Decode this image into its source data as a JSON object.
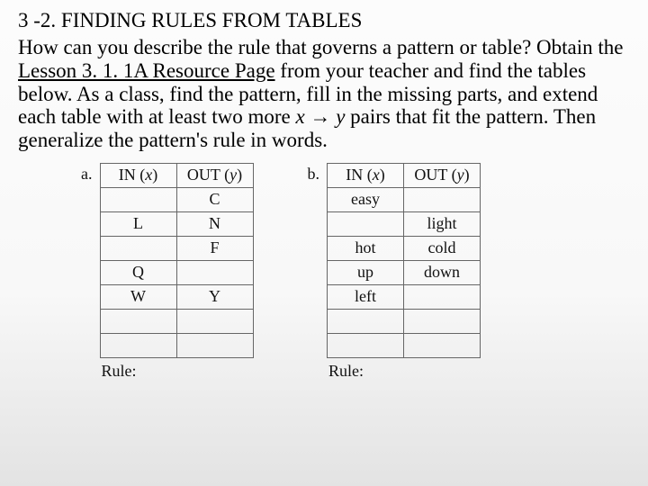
{
  "heading": {
    "num": "3 -2.",
    "title": "FINDING RULES FROM TABLES"
  },
  "paragraph": {
    "p1": "How can you describe the rule that governs a pattern or table?  Obtain the ",
    "resource": "Lesson 3. 1. 1A Resource Page",
    "p2": " from your teacher and find the tables below.  As a class, find the pattern, fill in the missing parts, and extend each table with at least two more ",
    "x": "x",
    "arrow": " → ",
    "y": "y",
    "p3": " pairs that fit the pattern.  Then generalize the pattern's rule in words."
  },
  "labels": {
    "a": "a.",
    "b": "b."
  },
  "headers": {
    "in_pre": "IN (",
    "in_var": "x",
    "in_post": ")",
    "out_pre": "OUT (",
    "out_var": "y",
    "out_post": ")"
  },
  "table_a": {
    "rows": [
      {
        "in": "",
        "out": "C"
      },
      {
        "in": "L",
        "out": "N"
      },
      {
        "in": "",
        "out": "F"
      },
      {
        "in": "Q",
        "out": ""
      },
      {
        "in": "W",
        "out": "Y"
      },
      {
        "in": "",
        "out": ""
      },
      {
        "in": "",
        "out": ""
      }
    ]
  },
  "table_b": {
    "rows": [
      {
        "in": "easy",
        "out": ""
      },
      {
        "in": "",
        "out": "light"
      },
      {
        "in": "hot",
        "out": "cold"
      },
      {
        "in": "up",
        "out": "down"
      },
      {
        "in": "left",
        "out": ""
      },
      {
        "in": "",
        "out": ""
      },
      {
        "in": "",
        "out": ""
      }
    ]
  },
  "rule_label": "Rule:"
}
